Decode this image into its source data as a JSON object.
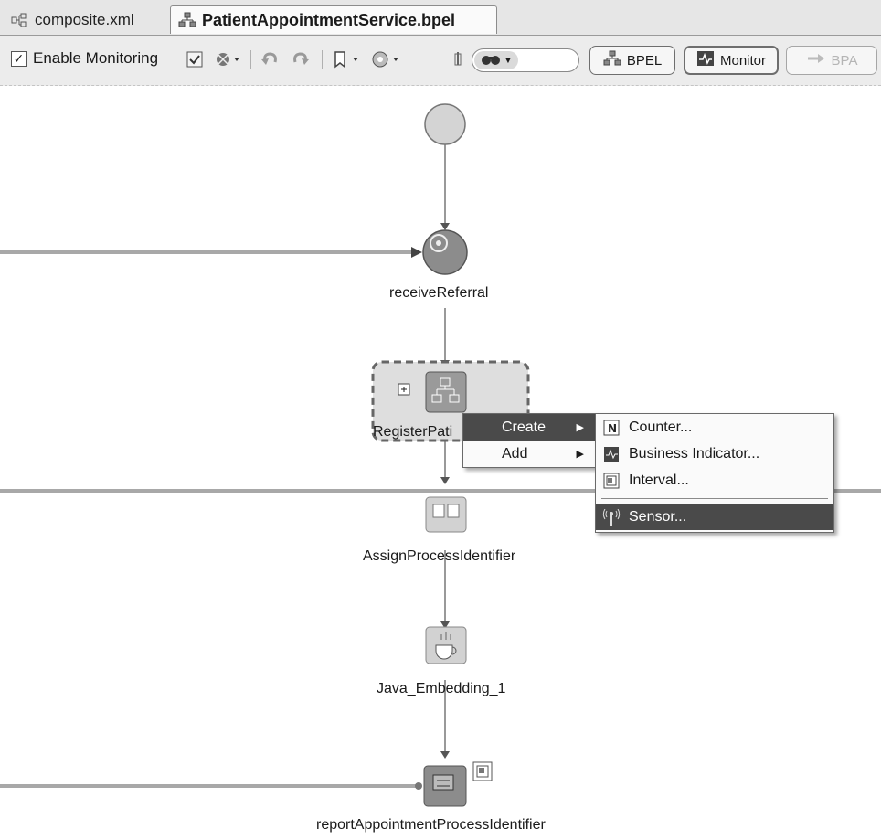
{
  "tabs": [
    {
      "label": "composite.xml",
      "icon": "composite-icon",
      "active": false
    },
    {
      "label": "PatientAppointmentService.bpel",
      "icon": "bpel-process-icon",
      "active": true
    }
  ],
  "toolbar": {
    "enable_monitoring_label": "Enable Monitoring",
    "enable_monitoring_checked": true,
    "bpel_label": "BPEL",
    "monitor_label": "Monitor",
    "bpa_label": "BPA"
  },
  "nodes": {
    "receive_referral": "receiveReferral",
    "register_patient": "RegisterPati",
    "assign_process_identifier": "AssignProcessIdentifier",
    "java_embedding": "Java_Embedding_1",
    "report_appointment": "reportAppointmentProcessIdentifier"
  },
  "context_menu": {
    "items": [
      {
        "label": "Create",
        "selected": true
      },
      {
        "label": "Add",
        "selected": false
      }
    ]
  },
  "submenu": {
    "items": [
      {
        "label": "Counter...",
        "icon": "counter-icon",
        "selected": false
      },
      {
        "label": "Business Indicator...",
        "icon": "business-indicator-icon",
        "selected": false
      },
      {
        "label": "Interval...",
        "icon": "interval-icon",
        "selected": false
      },
      {
        "label": "Sensor...",
        "icon": "sensor-icon",
        "selected": true
      }
    ]
  },
  "colors": {
    "menu_highlight": "#4a4a4a",
    "partner_link_line": "#a8a8a8",
    "node_fill": "#8c8c8c"
  }
}
